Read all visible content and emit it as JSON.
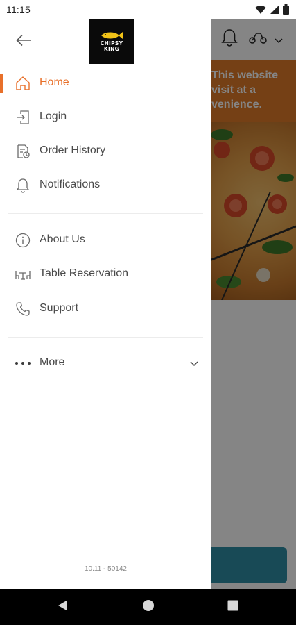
{
  "status_bar": {
    "time": "11:15",
    "icons": [
      "wifi-icon",
      "signal-icon",
      "battery-icon"
    ]
  },
  "background": {
    "banner_text": "This website visit at a venience.",
    "banner_lines": [
      "This website",
      "visit at a",
      "venience."
    ],
    "accent": "#e07c2a",
    "cta_color": "#2f8ea6"
  },
  "drawer": {
    "logo": {
      "line1": "CHIPSY",
      "line2": "KING"
    },
    "accent": "#e8702a",
    "items": [
      {
        "label": "Home",
        "icon": "home-icon",
        "active": true
      },
      {
        "label": "Login",
        "icon": "login-icon",
        "active": false
      },
      {
        "label": "Order History",
        "icon": "order-history-icon",
        "active": false
      },
      {
        "label": "Notifications",
        "icon": "bell-icon",
        "active": false
      },
      {
        "label": "About Us",
        "icon": "info-icon",
        "active": false
      },
      {
        "label": "Table Reservation",
        "icon": "table-icon",
        "active": false
      },
      {
        "label": "Support",
        "icon": "phone-icon",
        "active": false
      },
      {
        "label": "More",
        "icon": "more-icon",
        "active": false
      }
    ],
    "version": "10.11 - 50142"
  }
}
